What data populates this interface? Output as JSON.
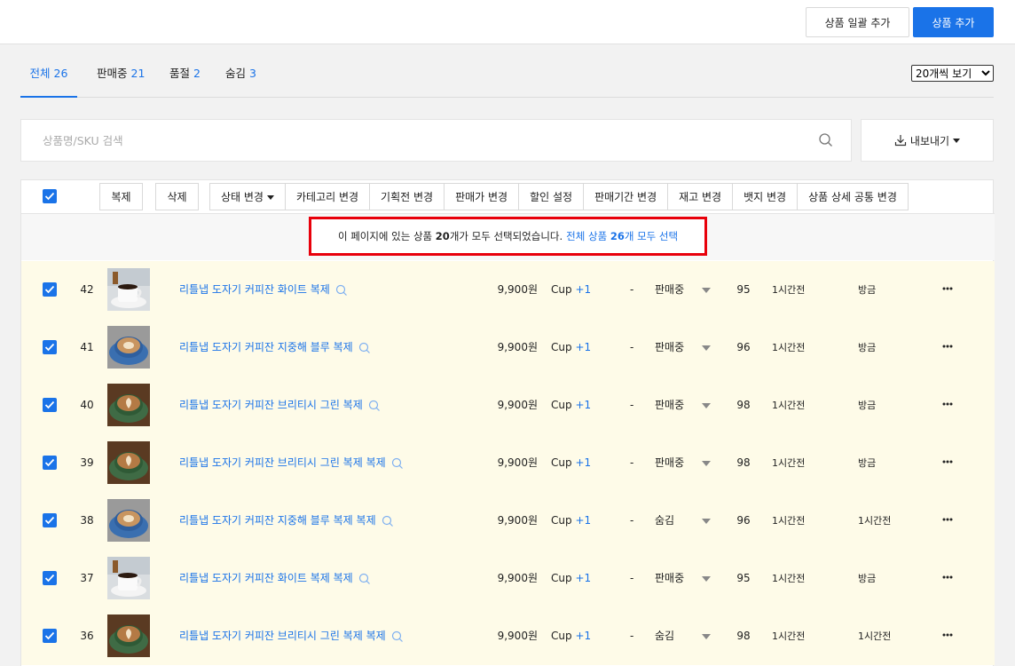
{
  "header": {
    "bulk_add_label": "상품 일괄 추가",
    "add_label": "상품 추가"
  },
  "tabs": [
    {
      "label": "전체",
      "count": "26"
    },
    {
      "label": "판매중",
      "count": "21"
    },
    {
      "label": "품절",
      "count": "2"
    },
    {
      "label": "숨김",
      "count": "3"
    }
  ],
  "per_page": {
    "selected": "20개씩 보기"
  },
  "search": {
    "placeholder": "상품명/SKU 검색"
  },
  "export": {
    "label": "내보내기"
  },
  "toolbar": {
    "duplicate": "복제",
    "delete": "삭제",
    "status_change": "상태 변경",
    "category_change": "카테고리 변경",
    "exhibition_change": "기획전 변경",
    "price_change": "판매가 변경",
    "discount": "할인 설정",
    "period_change": "판매기간 변경",
    "stock_change": "재고 변경",
    "badge_change": "뱃지 변경",
    "detail_common_change": "상품 상세 공통 변경"
  },
  "notice": {
    "text_before": "이 페이지에 있는 상품",
    "count": "20",
    "text_after": "개가 모두 선택되었습니다.",
    "link_before": "전체 상품",
    "link_count": "26",
    "link_after": "개 모두 선택"
  },
  "colors": {
    "accent": "#1a73e8",
    "highlight": "#e8000b",
    "row_bg": "#fefbe8"
  },
  "rows": [
    {
      "num": "42",
      "name": "리틀냅 도자기 커피잔 화이트 복제",
      "price": "9,900원",
      "unit": "Cup",
      "plus": "+1",
      "dash": "-",
      "status": "판매중",
      "stock": "95",
      "updated": "1시간전",
      "created": "방금",
      "thumb": "white"
    },
    {
      "num": "41",
      "name": "리틀냅 도자기 커피잔 지중해 블루 복제",
      "price": "9,900원",
      "unit": "Cup",
      "plus": "+1",
      "dash": "-",
      "status": "판매중",
      "stock": "96",
      "updated": "1시간전",
      "created": "방금",
      "thumb": "blue"
    },
    {
      "num": "40",
      "name": "리틀냅 도자기 커피잔 브리티시 그린 복제",
      "price": "9,900원",
      "unit": "Cup",
      "plus": "+1",
      "dash": "-",
      "status": "판매중",
      "stock": "98",
      "updated": "1시간전",
      "created": "방금",
      "thumb": "green"
    },
    {
      "num": "39",
      "name": "리틀냅 도자기 커피잔 브리티시 그린 복제 복제",
      "price": "9,900원",
      "unit": "Cup",
      "plus": "+1",
      "dash": "-",
      "status": "판매중",
      "stock": "98",
      "updated": "1시간전",
      "created": "방금",
      "thumb": "green"
    },
    {
      "num": "38",
      "name": "리틀냅 도자기 커피잔 지중해 블루 복제 복제",
      "price": "9,900원",
      "unit": "Cup",
      "plus": "+1",
      "dash": "-",
      "status": "숨김",
      "stock": "96",
      "updated": "1시간전",
      "created": "1시간전",
      "thumb": "blue"
    },
    {
      "num": "37",
      "name": "리틀냅 도자기 커피잔 화이트 복제 복제",
      "price": "9,900원",
      "unit": "Cup",
      "plus": "+1",
      "dash": "-",
      "status": "판매중",
      "stock": "95",
      "updated": "1시간전",
      "created": "방금",
      "thumb": "white"
    },
    {
      "num": "36",
      "name": "리틀냅 도자기 커피잔 브리티시 그린 복제 복제",
      "price": "9,900원",
      "unit": "Cup",
      "plus": "+1",
      "dash": "-",
      "status": "숨김",
      "stock": "98",
      "updated": "1시간전",
      "created": "1시간전",
      "thumb": "green"
    }
  ]
}
